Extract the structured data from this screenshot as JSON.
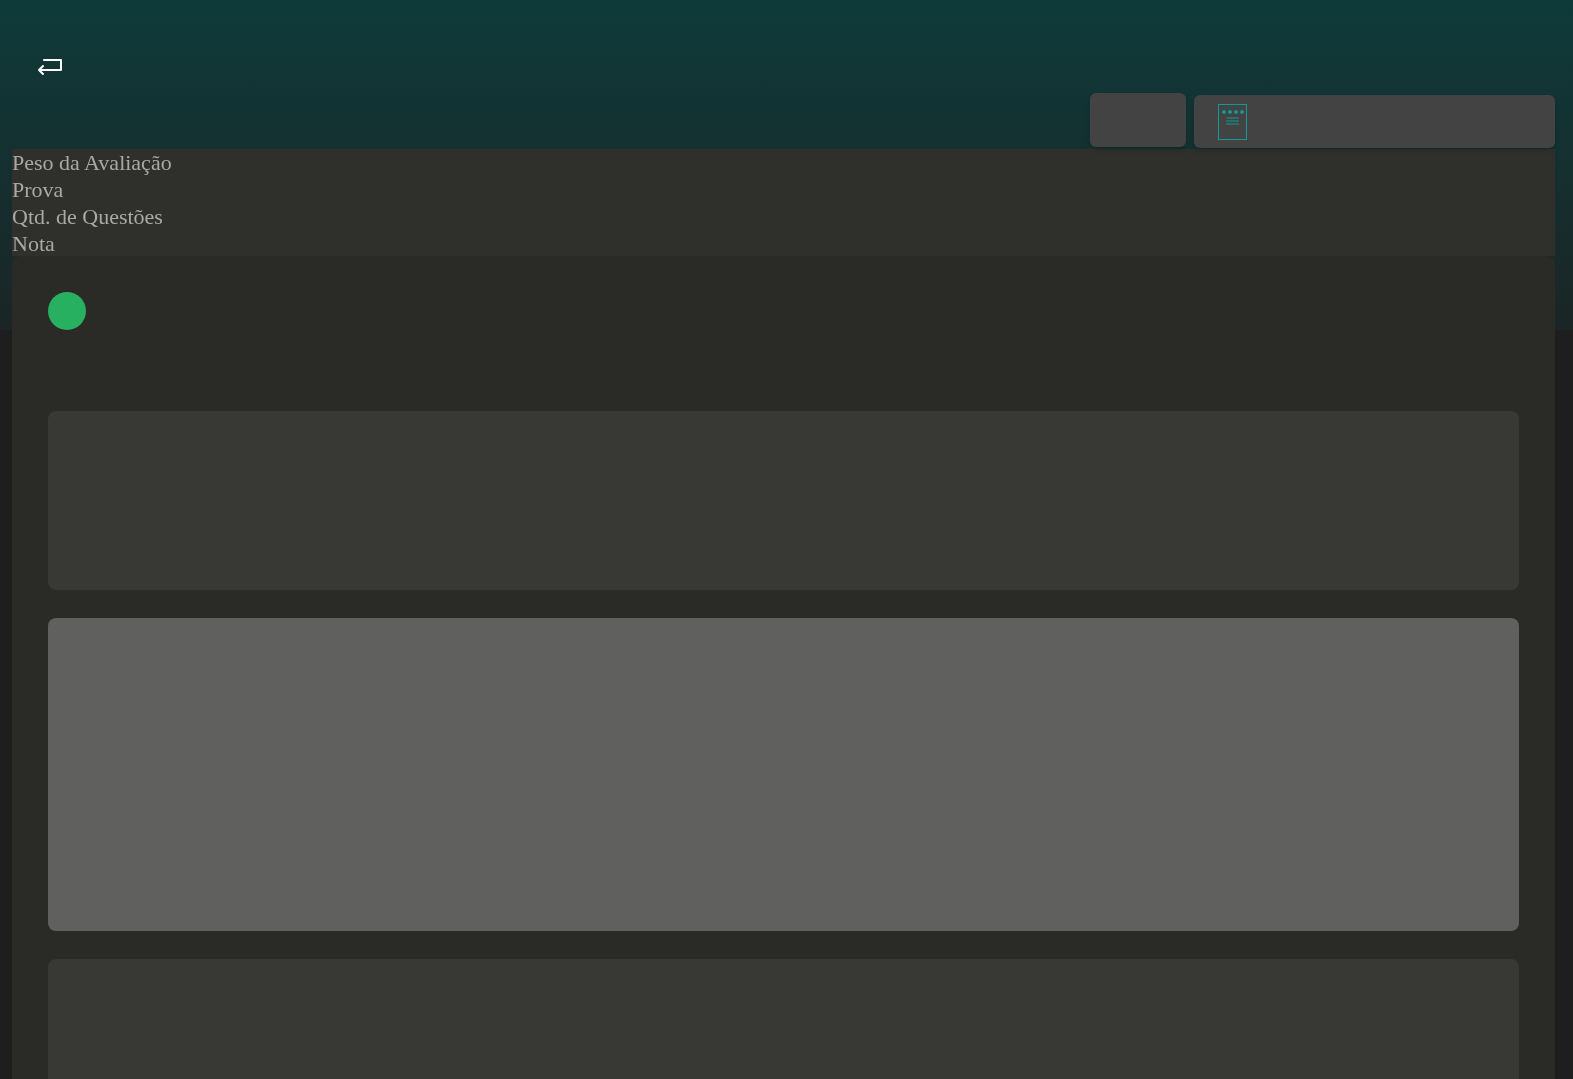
{
  "labels": [
    "Peso da Avaliação",
    "Prova",
    "Qtd. de Questões",
    "Nota"
  ]
}
